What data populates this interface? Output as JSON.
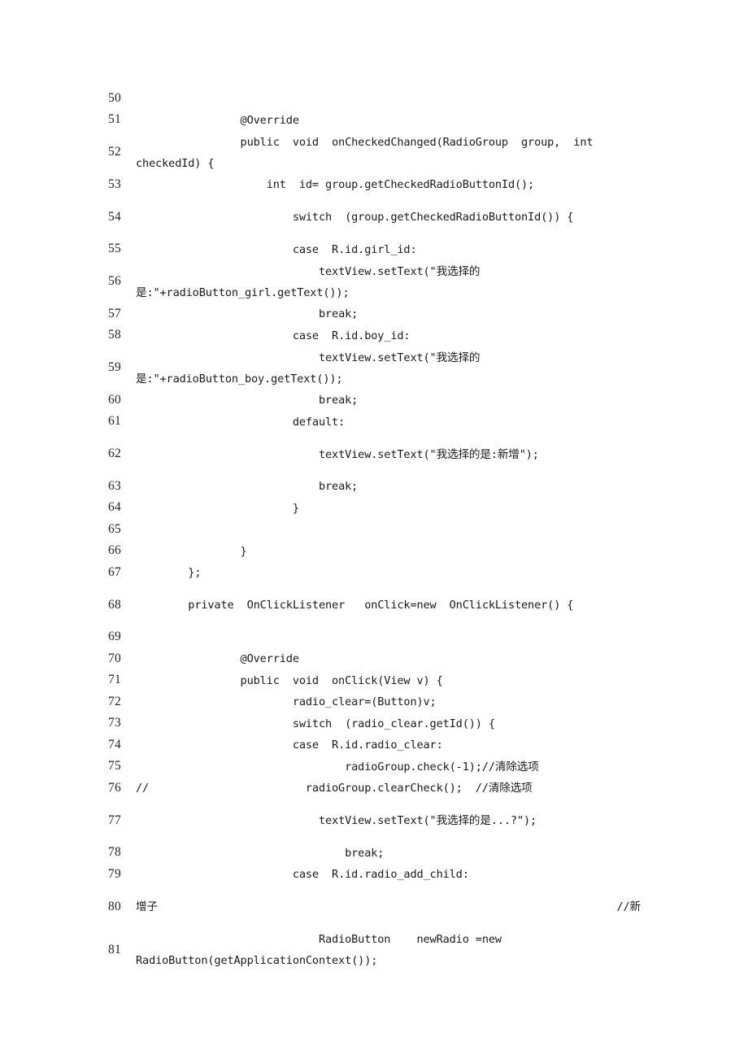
{
  "document": {
    "type": "code-listing",
    "language": "Java",
    "page_background": "#ffffff",
    "text_color": "#1a1a1a",
    "first_line_number": 50,
    "last_line_number": 81
  },
  "lines": [
    {
      "n": "50",
      "code": "",
      "wrapped": false
    },
    {
      "n": "51",
      "code": "                @Override",
      "wrapped": false
    },
    {
      "n": "52",
      "code": "                public  void  onCheckedChanged(RadioGroup  group,  int  checkedId) {",
      "wrapped": true
    },
    {
      "n": "53",
      "code": "                    int  id= group.getCheckedRadioButtonId();",
      "wrapped": false
    },
    {
      "n": "54",
      "code": "                        switch  (group.getCheckedRadioButtonId()) {",
      "wrapped": true
    },
    {
      "n": "55",
      "code": "                        case  R.id.girl_id:",
      "wrapped": false
    },
    {
      "n": "56",
      "code": "                            textView.setText(\"我选择的是:\"+radioButton_girl.getText());",
      "wrapped": true
    },
    {
      "n": "57",
      "code": "                            break;",
      "wrapped": false
    },
    {
      "n": "58",
      "code": "                        case  R.id.boy_id:",
      "wrapped": false
    },
    {
      "n": "59",
      "code": "                            textView.setText(\"我选择的是:\"+radioButton_boy.getText());",
      "wrapped": true
    },
    {
      "n": "60",
      "code": "                            break;",
      "wrapped": false
    },
    {
      "n": "61",
      "code": "                        default:",
      "wrapped": false
    },
    {
      "n": "62",
      "code": "                            textView.setText(\"我选择的是:新增\");",
      "wrapped": true
    },
    {
      "n": "63",
      "code": "                            break;",
      "wrapped": false
    },
    {
      "n": "64",
      "code": "                        }",
      "wrapped": false
    },
    {
      "n": "65",
      "code": "",
      "wrapped": false
    },
    {
      "n": "66",
      "code": "                }",
      "wrapped": false
    },
    {
      "n": "67",
      "code": "        };",
      "wrapped": false
    },
    {
      "n": "68",
      "code": "        private  OnClickListener   onClick=new  OnClickListener() {",
      "wrapped": true
    },
    {
      "n": "69",
      "code": "",
      "wrapped": false
    },
    {
      "n": "70",
      "code": "                @Override",
      "wrapped": false
    },
    {
      "n": "71",
      "code": "                public  void  onClick(View v) {",
      "wrapped": false
    },
    {
      "n": "72",
      "code": "                        radio_clear=(Button)v;",
      "wrapped": false
    },
    {
      "n": "73",
      "code": "                        switch  (radio_clear.getId()) {",
      "wrapped": false
    },
    {
      "n": "74",
      "code": "                        case  R.id.radio_clear:",
      "wrapped": false
    },
    {
      "n": "75",
      "code": "                                radioGroup.check(-1);//清除选项",
      "wrapped": false
    },
    {
      "n": "76",
      "code": "//                        radioGroup.clearCheck();  //清除选项",
      "wrapped": false
    },
    {
      "n": "77",
      "code": "                            textView.setText(\"我选择的是...?\");",
      "wrapped": true
    },
    {
      "n": "78",
      "code": "                                break;",
      "wrapped": false
    },
    {
      "n": "79",
      "code": "                        case  R.id.radio_add_child:",
      "wrapped": false
    },
    {
      "n": "80",
      "code": "增子",
      "trailing_comment": "//新",
      "wrapped": true
    },
    {
      "n": "81",
      "code": "                            RadioButton    newRadio =new  RadioButton(getApplicationContext());",
      "wrapped": true
    }
  ]
}
